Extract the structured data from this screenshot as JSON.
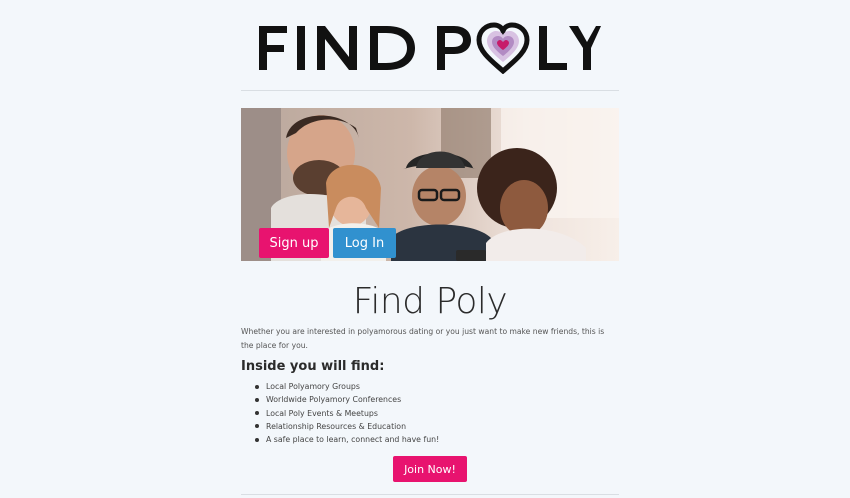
{
  "brand": {
    "logo_text": "FIND POLY",
    "colors": {
      "pink": "#e8136f",
      "blue": "#3191cf",
      "heart_outer": "#b28bc3",
      "heart_inner": "#c71b6a"
    }
  },
  "hero": {
    "signup_label": "Sign up",
    "login_label": "Log In"
  },
  "main": {
    "title": "Find Poly",
    "intro": "Whether you are interested in polyamorous dating or you just want to make new friends, this is the place for you.",
    "subhead": "Inside you will find:",
    "features": [
      "Local Polyamory Groups",
      "Worldwide Polyamory Conferences",
      "Local Poly Events & Meetups",
      "Relationship Resources & Education",
      "A safe place to learn, connect and have fun!"
    ],
    "join_label": "Join Now!"
  }
}
